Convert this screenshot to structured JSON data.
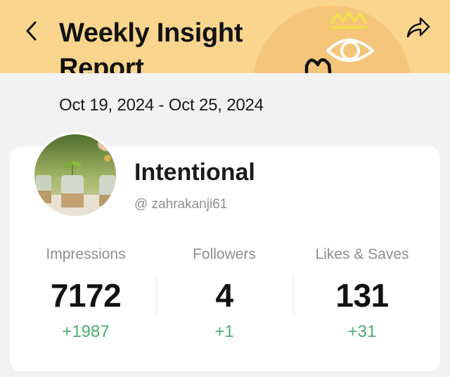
{
  "header": {
    "title": "Weekly Insight Report",
    "back_icon": "chevron-left-icon",
    "share_icon": "share-icon",
    "background_color": "#f9d58d"
  },
  "date_range": "Oct 19, 2024 - Oct 25, 2024",
  "profile": {
    "name": "Intentional",
    "handle": "@ zahrakanji61"
  },
  "stats": [
    {
      "label": "Impressions",
      "value": "7172",
      "delta": "+1987"
    },
    {
      "label": "Followers",
      "value": "4",
      "delta": "+1"
    },
    {
      "label": "Likes & Saves",
      "value": "131",
      "delta": "+31"
    }
  ],
  "colors": {
    "positive": "#4caf6e",
    "muted": "#8e8e8e"
  }
}
